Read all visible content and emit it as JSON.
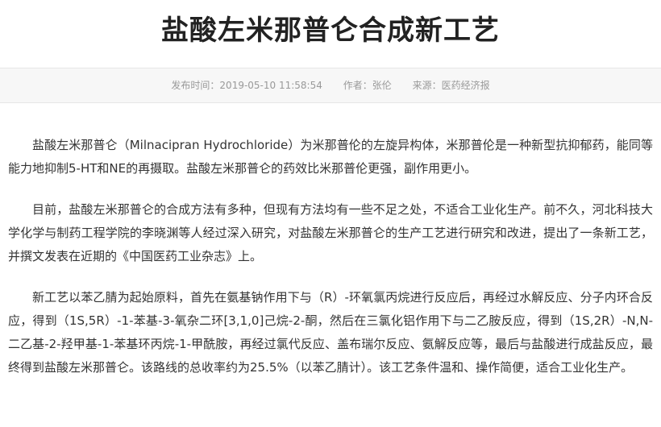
{
  "article": {
    "title": "盐酸左米那普仑合成新工艺",
    "meta": {
      "publish_label": "发布时间：",
      "publish_time": "2019-05-10 11:58:54",
      "author_label": "作者：",
      "author": "张伦",
      "source_label": "来源：",
      "source": "医药经济报"
    },
    "paragraphs": [
      "盐酸左米那普仑（Milnacipran Hydrochloride）为米那普伦的左旋异构体，米那普伦是一种新型抗抑郁药，能同等能力地抑制5-HT和NE的再摄取。盐酸左米那普仑的药效比米那普伦更强，副作用更小。",
      "目前，盐酸左米那普仑的合成方法有多种，但现有方法均有一些不足之处，不适合工业化生产。前不久，河北科技大学化学与制药工程学院的李晓渊等人经过深入研究，对盐酸左米那普仑的生产工艺进行研究和改进，提出了一条新工艺，并撰文发表在近期的《中国医药工业杂志》上。",
      "新工艺以苯乙腈为起始原料，首先在氨基钠作用下与（R）-环氧氯丙烷进行反应后，再经过水解反应、分子内环合反应，得到（1S,5R）-1-苯基-3-氧杂二环[3,1,0]己烷-2-酮，然后在三氯化铝作用下与二乙胺反应，得到（1S,2R）-N,N-二乙基-2-羟甲基-1-苯基环丙烷-1-甲酰胺，再经过氯代反应、盖布瑞尔反应、氨解反应等，最后与盐酸进行成盐反应，最终得到盐酸左米那普仑。该路线的总收率约为25.5%（以苯乙腈计）。该工艺条件温和、操作简便，适合工业化生产。"
    ]
  }
}
